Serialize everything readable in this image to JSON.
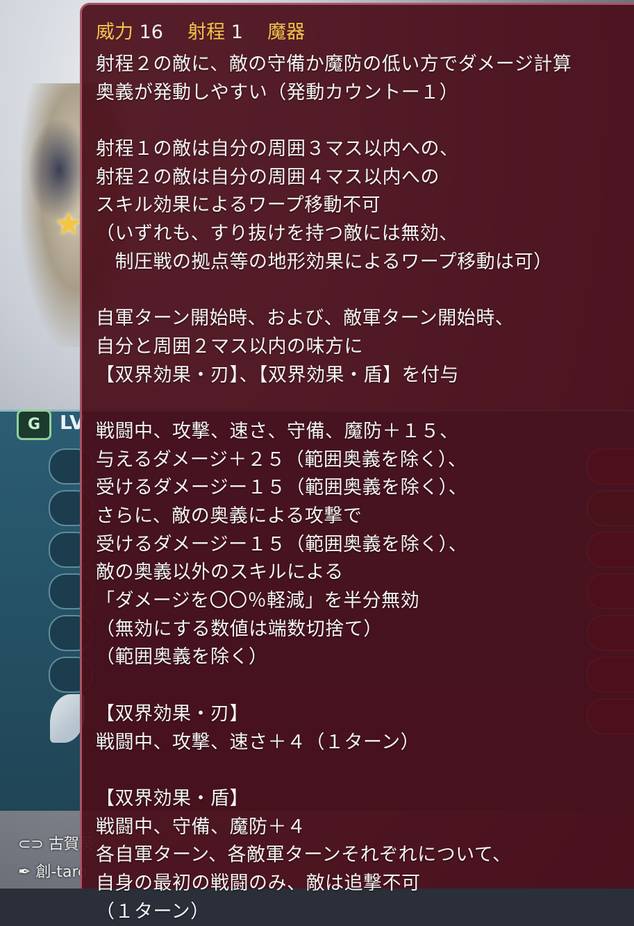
{
  "weapon": {
    "might_label": "威力",
    "might_value": "16",
    "range_label": "射程",
    "range_value": "1",
    "type": "魔器"
  },
  "description_lines": [
    "射程２の敵に、敵の守備か魔防の低い方でダメージ計算",
    "奥義が発動しやすい（発動カウントー１）",
    "",
    "射程１の敵は自分の周囲３マス以内への、",
    "射程２の敵は自分の周囲４マス以内への",
    "スキル効果によるワープ移動不可",
    "（いずれも、すり抜けを持つ敵には無効、",
    "　制圧戦の拠点等の地形効果によるワープ移動は可）",
    "",
    "自軍ターン開始時、および、敵軍ターン開始時、",
    "自分と周囲２マス以内の味方に",
    "【双界効果・刃】、【双界効果・盾】を付与",
    "",
    "戦闘中、攻撃、速さ、守備、魔防＋１５、",
    "与えるダメージ＋２５（範囲奥義を除く）、",
    "受けるダメージー１５（範囲奥義を除く）、",
    "さらに、敵の奥義による攻撃で",
    "受けるダメージー１５（範囲奥義を除く）、",
    "敵の奥義以外のスキルによる",
    "「ダメージを〇〇％軽減」を半分無効",
    "（無効にする数値は端数切捨て）",
    "（範囲奥義を除く）",
    "",
    "【双界効果・刃】",
    "戦闘中、攻撃、速さ＋４（１ターン）",
    "",
    "【双界効果・盾】",
    "戦闘中、守備、魔防＋４",
    "各自軍ターン、各敵軍ターンそれぞれについて、",
    "自身の最初の戦闘のみ、敵は追撃不可",
    "（１ターン）"
  ],
  "background": {
    "level_badge": "G",
    "level_text": "LV",
    "credits": [
      "古賀葵",
      "創-taro"
    ],
    "credit_icons": [
      "voice-actor-icon",
      "artist-pen-icon"
    ]
  },
  "colors": {
    "tooltip_bg": "#4a0e1a",
    "label_gold": "#f5c24a",
    "text_white": "#f3f3f3"
  }
}
